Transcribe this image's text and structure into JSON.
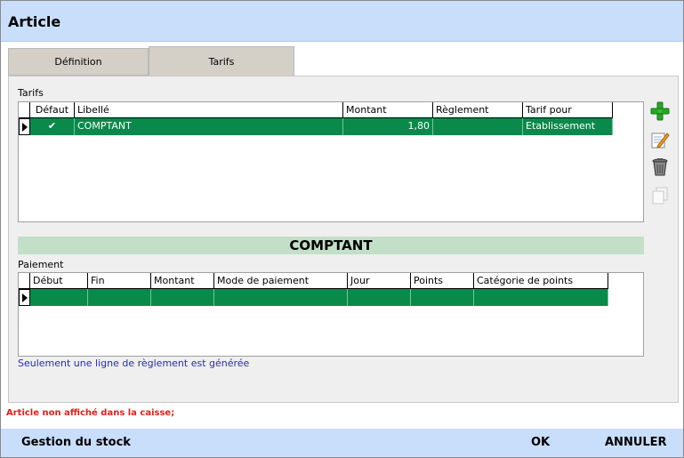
{
  "window": {
    "title": "Article"
  },
  "tabs": [
    {
      "label": "Définition"
    },
    {
      "label": "Tarifs"
    }
  ],
  "tarifs": {
    "section_label": "Tarifs",
    "columns": [
      "Défaut",
      "Libellé",
      "Montant",
      "Règlement",
      "Tarif pour"
    ],
    "rows": [
      {
        "defaut": "✔",
        "libelle": "COMPTANT",
        "montant": "1,80",
        "reglement": "",
        "tarif_pour": "Etablissement"
      }
    ]
  },
  "selected_tarif_banner": "COMPTANT",
  "paiement": {
    "section_label": "Paiement",
    "columns": [
      "Début",
      "Fin",
      "Montant",
      "Mode de paiement",
      "Jour",
      "Points",
      "Catégorie de points"
    ],
    "rows": [
      {
        "debut": "",
        "fin": "",
        "montant": "",
        "mode": "",
        "jour": "",
        "points": "",
        "categorie": ""
      }
    ]
  },
  "note": "Seulement une ligne de règlement est générée",
  "warning": "Article non affiché dans la caisse;",
  "footer": {
    "stock_label": "Gestion du stock",
    "ok_label": "OK",
    "cancel_label": "ANNULER"
  },
  "icons": {
    "add": "plus-icon",
    "edit": "edit-icon",
    "delete": "trash-icon",
    "duplicate": "copy-icon"
  },
  "colors": {
    "header_bg": "#c9defb",
    "row_selected": "#0a8a4a",
    "banner_bg": "#c3dfc8",
    "warning": "#e0201a",
    "note": "#2a2ab8"
  }
}
